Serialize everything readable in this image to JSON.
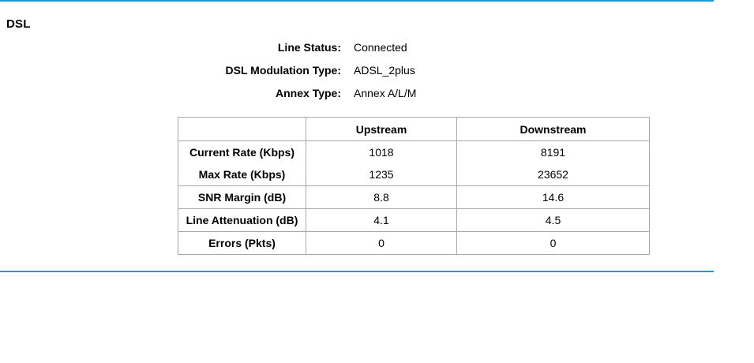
{
  "section": {
    "title": "DSL"
  },
  "info": [
    {
      "label": "Line Status:",
      "value": "Connected"
    },
    {
      "label": "DSL Modulation Type:",
      "value": "ADSL_2plus"
    },
    {
      "label": "Annex Type:",
      "value": "Annex A/L/M"
    }
  ],
  "table": {
    "headers": [
      "",
      "Upstream",
      "Downstream"
    ],
    "rows": [
      {
        "label": "Current Rate (Kbps)",
        "up": "1018",
        "down": "8191"
      },
      {
        "label": "Max Rate (Kbps)",
        "up": "1235",
        "down": "23652"
      },
      {
        "label": "SNR Margin (dB)",
        "up": "8.8",
        "down": "14.6"
      },
      {
        "label": "Line Attenuation (dB)",
        "up": "4.1",
        "down": "4.5"
      },
      {
        "label": "Errors (Pkts)",
        "up": "0",
        "down": "0"
      }
    ]
  },
  "colors": {
    "rule": "#1a9bd7",
    "table_border": "#a8a8a8"
  }
}
